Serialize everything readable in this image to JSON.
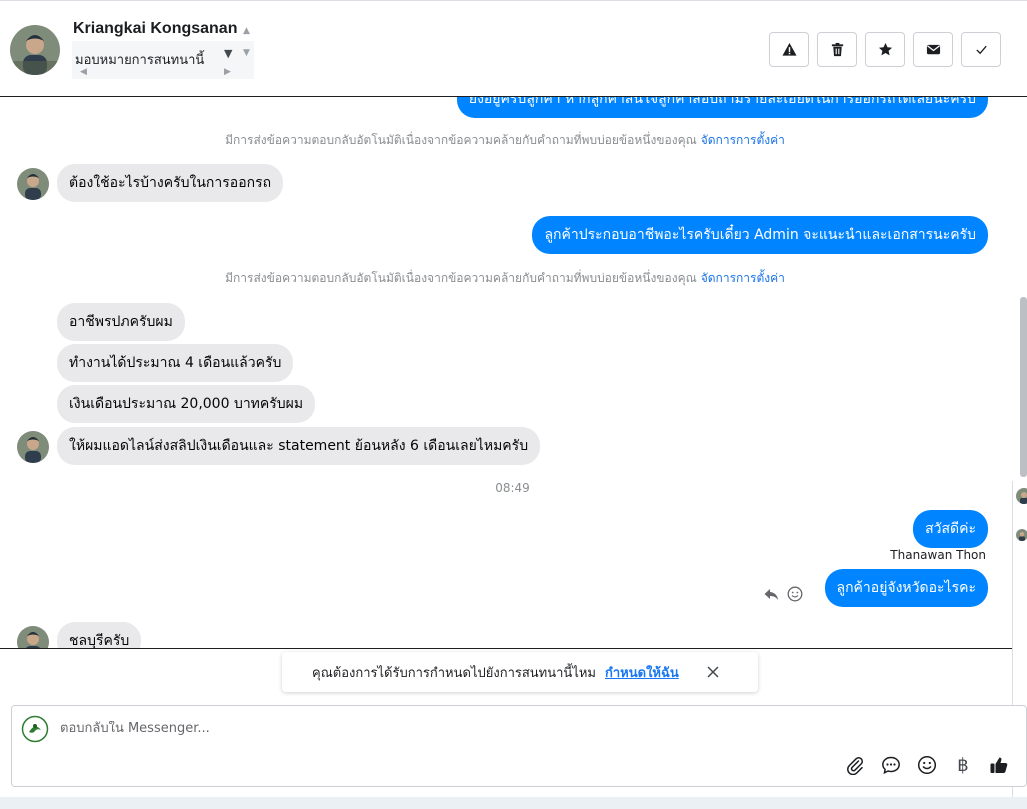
{
  "header": {
    "contact_name": "Kriangkai Kongsanan",
    "assign_label": "มอบหมายการสนทนานี้",
    "actions": [
      {
        "icon": "warning-icon",
        "label": "report"
      },
      {
        "icon": "trash-icon",
        "label": "delete"
      },
      {
        "icon": "star-icon",
        "label": "star"
      },
      {
        "icon": "envelope-icon",
        "label": "mark-unread"
      },
      {
        "icon": "check-icon",
        "label": "done"
      }
    ]
  },
  "conversation": {
    "top_partial_text": "ยังอยู่ครับลูกค้า หากลูกค้าสนใจลูกค้าสอบถามรายละเอียดในการออกรถได้เลยนะครับ",
    "auto_reply_note": "มีการส่งข้อความตอบกลับอัตโนมัติเนื่องจากข้อความคล้ายกับคำถามที่พบบ่อยข้อหนึ่งของคุณ",
    "manage_settings_link": "จัดการการตั้งค่า",
    "messages": {
      "m1": "ต้องใช้อะไรบ้างครับในการออกรถ",
      "m2": "ลูกค้าประกอบอาชีพอะไรครับเดี๋ยว Admin จะแนะนำและเอกสารนะครับ",
      "m3": "อาชีพรปภครับผม",
      "m4": "ทำงานได้ประมาณ 4 เดือนแล้วครับ",
      "m5": "เงินเดือนประมาณ 20,000 บาทครับผม",
      "m6": "ให้ผมแอดไลน์ส่งสลิปเงินเดือนและ statement ย้อนหลัง 6 เดือนเลยไหมครับ",
      "m7": "สวัสดีค่ะ",
      "m8": "ลูกค้าอยู่จังหวัดอะไรคะ",
      "m9": "ชลบุรีครับ"
    },
    "timestamp": "08:49",
    "sender_name": "Thanawan Thon"
  },
  "suggestion": {
    "text": "คุณต้องการได้รับการกำหนดไปยังการสนทนานี้ไหม",
    "link": "กำหนดให้ฉัน"
  },
  "composer": {
    "placeholder": "ตอบกลับใน Messenger...",
    "tools": [
      "paperclip-icon",
      "saved-replies-icon",
      "emoji-icon",
      "baht-icon",
      "thumbs-up-icon"
    ],
    "baht_symbol": "฿"
  },
  "colors": {
    "outgoing_bubble": "#0084ff",
    "incoming_bubble": "#e9e9eb",
    "link": "#1877f2"
  }
}
